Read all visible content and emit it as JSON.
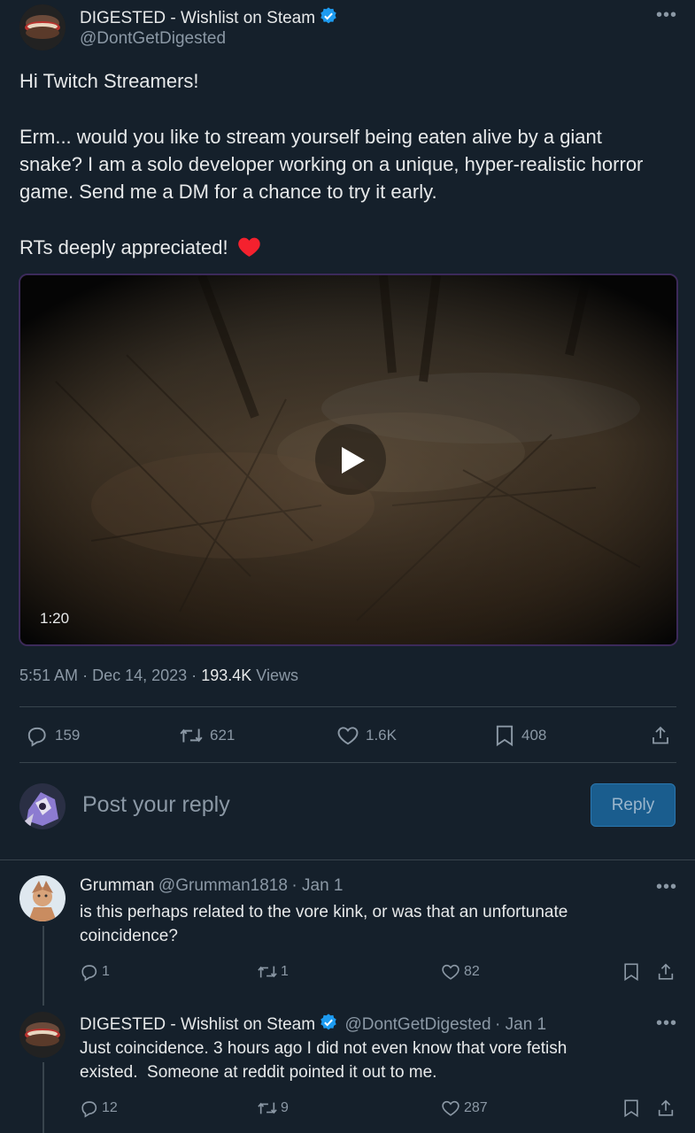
{
  "tweet": {
    "author_name": "DIGESTED - Wishlist on Steam",
    "author_handle": "@DontGetDigested",
    "text_line1": "Hi Twitch Streamers!",
    "text_p2_l1": "Erm... would you like to stream yourself being eaten alive by a giant",
    "text_p2_l2": "snake? I am a solo developer working on a unique, hyper-realistic horror",
    "text_p2_l3": "game. Send me a DM for a chance to try it early.",
    "text_p3": "RTs deeply appreciated!",
    "video_duration": "1:20",
    "time": "5:51 AM",
    "date": "Dec 14, 2023",
    "views_count": "193.4K",
    "views_label": "Views",
    "sep": "·"
  },
  "actions": {
    "replies": "159",
    "retweets": "621",
    "likes": "1.6K",
    "bookmarks": "408"
  },
  "compose": {
    "placeholder": "Post your reply",
    "button_label": "Reply"
  },
  "replies": [
    {
      "name": "Grumman",
      "handle": "@Grumman1818",
      "date": "· Jan 1",
      "line1": "is this perhaps related to the vore kink, or was that an unfortunate",
      "line2": "coincidence?",
      "replies": "1",
      "retweets": "1",
      "likes": "82"
    },
    {
      "name": "DIGESTED - Wishlist on Steam",
      "handle": "@DontGetDigested",
      "date": "· Jan 1",
      "line1": "Just coincidence. 3 hours ago I did not even know that vore fetish",
      "line2": "existed.  Someone at reddit pointed it out to me.",
      "replies": "12",
      "retweets": "9",
      "likes": "287"
    }
  ],
  "colors": {
    "background": "#15202b",
    "verified": "#1d9bf0",
    "reply_button": "#1a5d8e",
    "heart": "#f4212e"
  },
  "icons": [
    "more-icon",
    "verified-icon",
    "heart-emoji-icon",
    "play-icon",
    "reply-icon",
    "retweet-icon",
    "like-icon",
    "bookmark-icon",
    "share-icon"
  ]
}
